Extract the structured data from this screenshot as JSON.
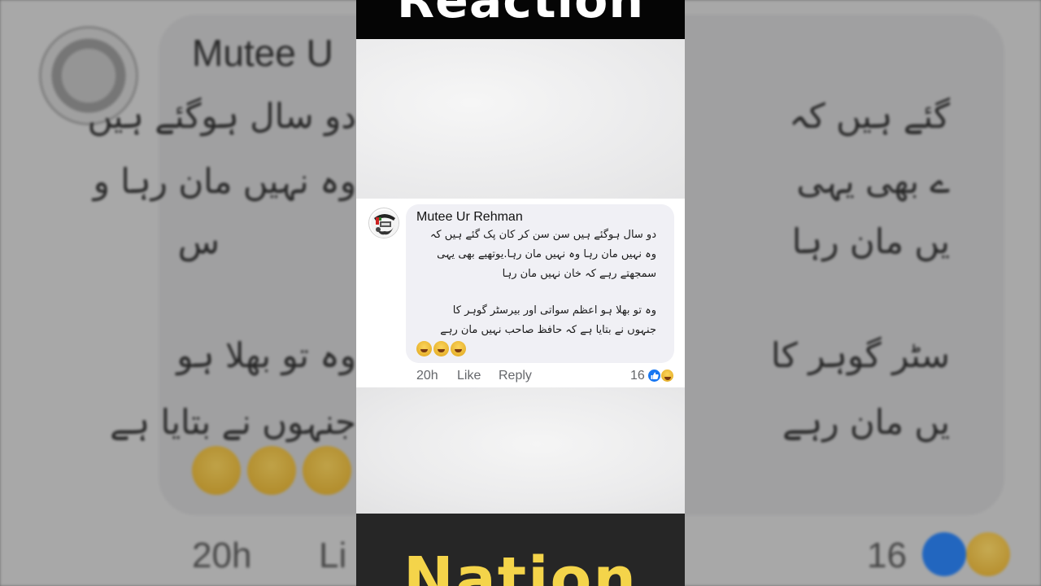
{
  "banner": {
    "top_text": "Reaction",
    "bottom_text": "Nation"
  },
  "comment": {
    "author": "Mutee Ur Rehman",
    "lines": [
      "دو سال ہوگئے ہیں سن سن کر کان پک گئے ہیں کہ",
      "وہ نہیں مان رہا وہ نہیں مان رہا.یوتھیے بھی یہی",
      "سمجھتے رہے کہ خان نہیں مان رہا",
      "وہ تو بھلا ہو اعظم سواتی اور بیرسٹر گوہر کا",
      "جنہوں نے بتایا ہے کہ حافظ صاحب نہیں مان رہے"
    ],
    "emojis": [
      "laughing-emoji",
      "relieved-emoji",
      "laughing-emoji"
    ],
    "time": "20h",
    "like_label": "Like",
    "reply_label": "Reply",
    "reaction_count": "16",
    "reactions": [
      "like-icon",
      "haha-icon"
    ]
  },
  "background_zoom": {
    "author_partial": "Mutee U",
    "line1_partial": "دو سال ہوگئے ہیں",
    "line1_end": "گئے ہیں کہ",
    "line2_partial": "وہ نہیں مان رہا و",
    "line2_end": "ے بھی یہی",
    "line3_partial": "س",
    "line3_end": "یں مان رہا",
    "line4_partial": "وہ تو بھلا ہو",
    "line4_end": "سٹر گوہر کا",
    "line5_partial": "جنہوں نے بتایا ہے",
    "line5_end": "یں مان رہے",
    "time": "20h",
    "like_partial": "Li",
    "reaction_count": "16"
  },
  "colors": {
    "like_blue": "#1877f2",
    "bottom_banner_text": "#f4d44a",
    "bubble": "#f0f0f5"
  }
}
